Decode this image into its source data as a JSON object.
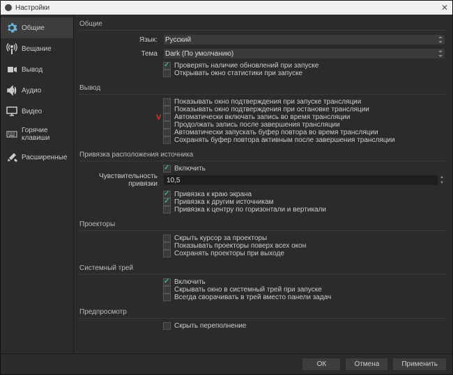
{
  "window": {
    "title": "Настройки"
  },
  "sidebar": {
    "items": [
      {
        "label": "Общие"
      },
      {
        "label": "Вещание"
      },
      {
        "label": "Вывод"
      },
      {
        "label": "Аудио"
      },
      {
        "label": "Видео"
      },
      {
        "label": "Горячие клавиши"
      },
      {
        "label": "Расширенные"
      }
    ]
  },
  "general": {
    "title": "Общие",
    "language_label": "Язык:",
    "language_value": "Русский",
    "theme_label": "Тема",
    "theme_value": "Dark (По умолчанию)",
    "check_updates": "Проверять наличие обновлений при запуске",
    "open_stats": "Открывать окно статистики при запуске"
  },
  "output": {
    "title": "Вывод",
    "confirm_start": "Показывать окно подтверждения при запуске трансляции",
    "confirm_stop": "Показывать окно подтверждения при остановке трансляции",
    "auto_record": "Автоматически включать запись во время трансляции",
    "continue_record": "Продолжать запись после завершения трансляции",
    "auto_replay": "Автоматически запускать буфер повтора во время трансляции",
    "keep_replay": "Сохранять буфер повтора активным после завершения трансляции"
  },
  "snap": {
    "title": "Привязка расположения источника",
    "enable": "Включить",
    "sens_label": "Чувствительность привязки",
    "sens_value": "10,5",
    "snap_edge": "Привязка к краю экрана",
    "snap_sources": "Привязка к другим источникам",
    "snap_center": "Привязка к центру по горизонтали и вертикали"
  },
  "projectors": {
    "title": "Проекторы",
    "hide_cursor": "Скрыть курсор за проекторы",
    "always_top": "Показывать проекторы поверх всех окон",
    "save_exit": "Сохранять проекторы при выходе"
  },
  "tray": {
    "title": "Системный трей",
    "enable": "Включить",
    "hide_start": "Скрывать окно в системный трей при запуске",
    "always_min": "Всегда сворачивать в трей вместо панели задач"
  },
  "preview": {
    "title": "Предпросмотр",
    "hide_overflow": "Скрыть переполнение"
  },
  "footer": {
    "ok": "ОК",
    "cancel": "Отмена",
    "apply": "Применить"
  }
}
